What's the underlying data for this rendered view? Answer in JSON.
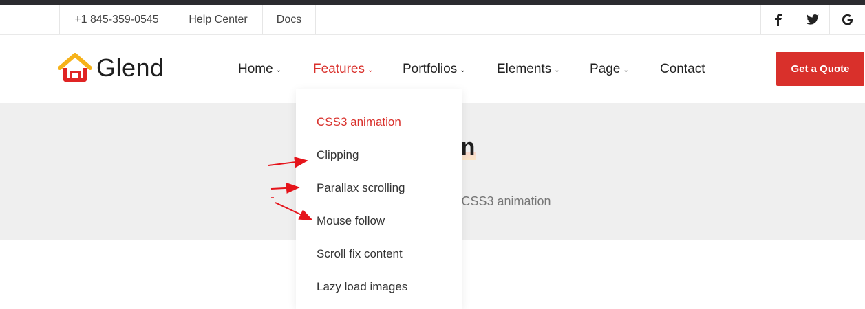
{
  "topbar": {
    "phone": "+1 845-359-0545",
    "help_center": "Help Center",
    "docs": "Docs",
    "social": [
      "facebook-icon",
      "twitter-icon",
      "google-icon"
    ]
  },
  "header": {
    "brand": "Glend",
    "nav": [
      {
        "label": "Home",
        "dropdown": true
      },
      {
        "label": "Features",
        "dropdown": true,
        "active": true
      },
      {
        "label": "Portfolios",
        "dropdown": true
      },
      {
        "label": "Elements",
        "dropdown": true
      },
      {
        "label": "Page",
        "dropdown": true
      },
      {
        "label": "Contact",
        "dropdown": false
      }
    ],
    "cta": "Get a Quote"
  },
  "dropdown": {
    "items": [
      "CSS3 animation",
      "Clipping",
      "Parallax scrolling",
      "Mouse follow",
      "Scroll fix content",
      "Lazy load images"
    ],
    "active_index": 0
  },
  "page": {
    "title_visible": "imation",
    "breadcrumb_visible": "- CSS3 animation"
  },
  "colors": {
    "accent": "#d9302b",
    "logo_yellow": "#f6b21a",
    "band": "#efefef",
    "annotation_arrow": "#e5141b"
  }
}
